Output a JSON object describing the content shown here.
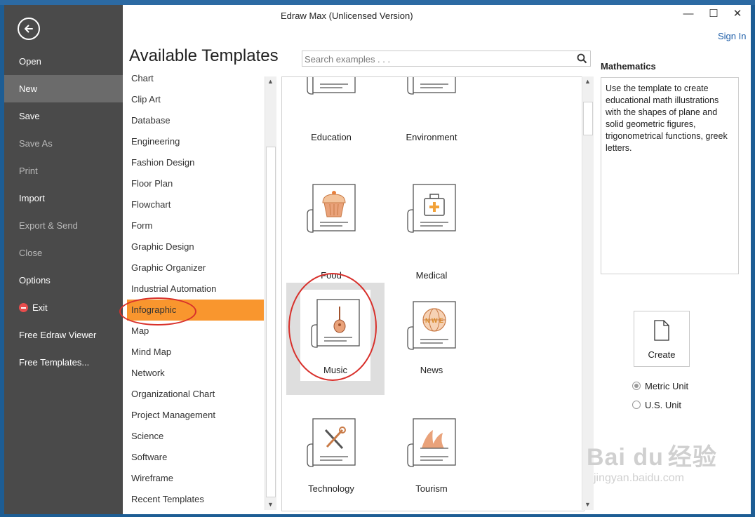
{
  "window": {
    "title": "Edraw Max (Unlicensed Version)",
    "sign_in": "Sign In",
    "controls": {
      "close_glyph": "✕",
      "maximize_glyph": "☐",
      "minimize_glyph": "—"
    }
  },
  "sidebar": {
    "back_icon": "back-arrow-icon",
    "items": [
      {
        "label": "Open",
        "state": "normal"
      },
      {
        "label": "New",
        "state": "active"
      },
      {
        "label": "Save",
        "state": "normal"
      },
      {
        "label": "Save As",
        "state": "disabled"
      },
      {
        "label": "Print",
        "state": "disabled"
      },
      {
        "label": "Import",
        "state": "normal"
      },
      {
        "label": "Export & Send",
        "state": "disabled"
      },
      {
        "label": "Close",
        "state": "disabled"
      },
      {
        "label": "Options",
        "state": "normal"
      },
      {
        "label": "Exit",
        "state": "normal",
        "icon": "exit-icon"
      },
      {
        "label": "Free Edraw Viewer",
        "state": "normal"
      },
      {
        "label": "Free Templates...",
        "state": "normal"
      }
    ]
  },
  "main": {
    "title": "Available Templates",
    "search_placeholder": "Search examples . . .",
    "categories": [
      "Chart",
      "Clip Art",
      "Database",
      "Engineering",
      "Fashion Design",
      "Floor Plan",
      "Flowchart",
      "Form",
      "Graphic Design",
      "Graphic Organizer",
      "Industrial Automation",
      "Infographic",
      "Map",
      "Mind Map",
      "Network",
      "Organizational Chart",
      "Project Management",
      "Science",
      "Software",
      "Wireframe",
      "Recent Templates"
    ],
    "selected_category": "Infographic",
    "templates": [
      {
        "label": "Education",
        "icon": "graduation-cap-icon"
      },
      {
        "label": "Environment",
        "icon": "building-tree-icon"
      },
      {
        "label": "Food",
        "icon": "cupcake-icon"
      },
      {
        "label": "Medical",
        "icon": "first-aid-kit-icon"
      },
      {
        "label": "Music",
        "icon": "guitar-icon"
      },
      {
        "label": "News",
        "icon": "globe-nwe-icon"
      },
      {
        "label": "Technology",
        "icon": "wrench-screwdriver-icon"
      },
      {
        "label": "Tourism",
        "icon": "opera-house-icon"
      }
    ],
    "selected_template": "Music",
    "globe_letters": "N W E"
  },
  "details": {
    "title": "Mathematics",
    "description": "Use the template to create educational math illustrations with the shapes of plane and solid geometric figures, trigonometrical functions, greek letters.",
    "create_label": "Create",
    "units": [
      {
        "label": "Metric Unit",
        "checked": true
      },
      {
        "label": "U.S. Unit",
        "checked": false
      }
    ]
  },
  "watermark": {
    "brand": "Bai du",
    "cn": "经验",
    "url": "jingyan.baidu.com"
  },
  "colors": {
    "accent": "#f9962e",
    "sidebar": "#4a4a4a",
    "annotation": "#d8302b"
  }
}
